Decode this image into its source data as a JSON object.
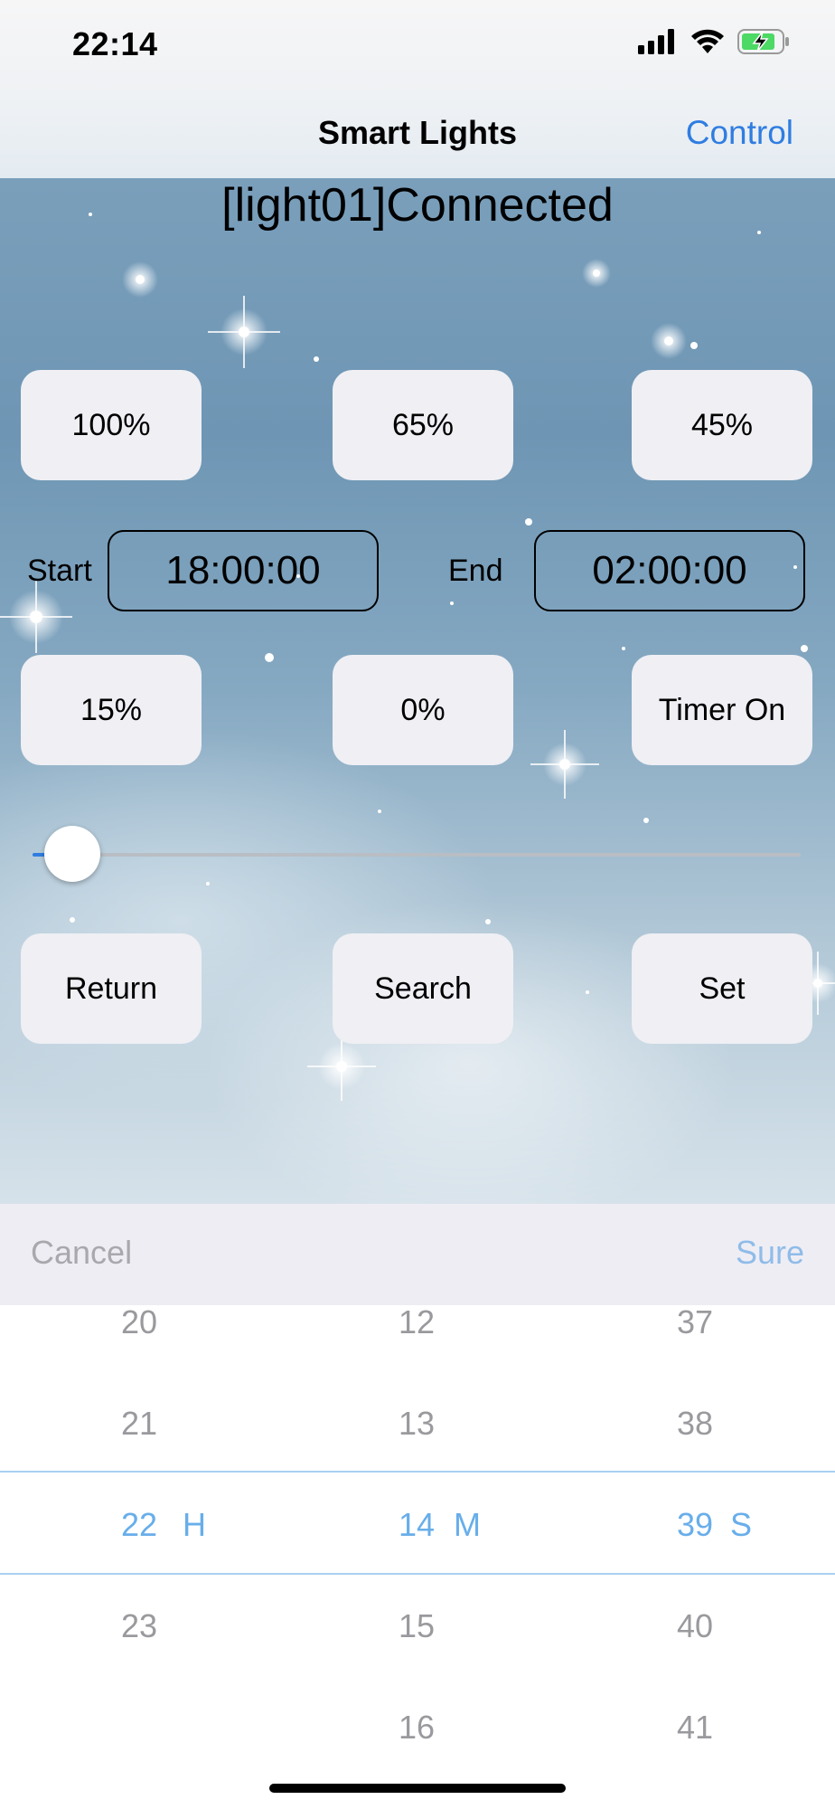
{
  "status_bar": {
    "time": "22:14",
    "icons": [
      "signal-icon",
      "wifi-icon",
      "battery-charging-icon"
    ]
  },
  "nav": {
    "title": "Smart Lights",
    "right_action": "Control"
  },
  "connection_status": "[light01]Connected",
  "brightness_buttons": [
    "100%",
    "65%",
    "45%",
    "15%",
    "0%"
  ],
  "timer": {
    "start_label": "Start",
    "start_value": "18:00:00",
    "end_label": "End",
    "end_value": "02:00:00",
    "timer_button": "Timer On"
  },
  "slider": {
    "value": 0.02
  },
  "actions": {
    "return": "Return",
    "search": "Search",
    "set": "Set"
  },
  "picker": {
    "cancel": "Cancel",
    "sure": "Sure",
    "hours": [
      "20",
      "21",
      "22",
      "23"
    ],
    "minutes": [
      "12",
      "13",
      "14",
      "15",
      "16"
    ],
    "seconds": [
      "37",
      "38",
      "39",
      "40",
      "41"
    ],
    "selected": {
      "hour": "22",
      "minute": "14",
      "second": "39"
    },
    "units": {
      "hour": "H",
      "minute": "M",
      "second": "S"
    }
  },
  "colors": {
    "accent": "#2f7de1",
    "picker_selected": "#68aeea",
    "button_bg": "#efeff4"
  }
}
